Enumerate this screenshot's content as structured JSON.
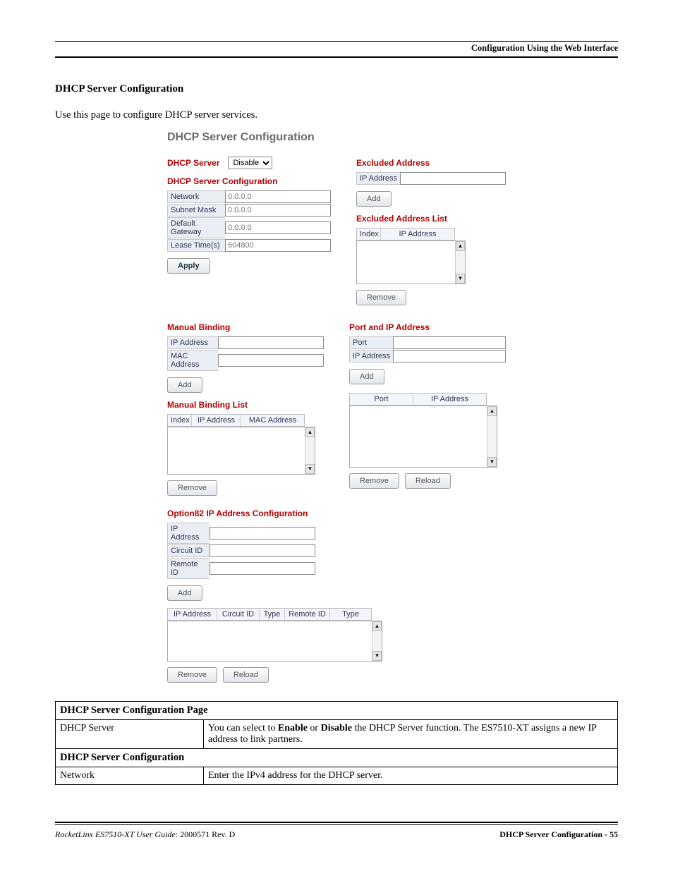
{
  "page_header": "Configuration Using the Web Interface",
  "section_title": "DHCP Server Configuration",
  "intro": "Use this page to configure DHCP server services.",
  "ui": {
    "panel_title": "DHCP Server Configuration",
    "dhcp_server_label": "DHCP Server",
    "dhcp_select_value": "Disable",
    "server_config_hdr": "DHCP Server Configuration",
    "fields": {
      "network": {
        "label": "Network",
        "placeholder": "0.0.0.0"
      },
      "subnet": {
        "label": "Subnet Mask",
        "placeholder": "0.0.0.0"
      },
      "gateway": {
        "label": "Default Gateway",
        "placeholder": "0.0.0.0"
      },
      "lease": {
        "label": "Lease Time(s)",
        "placeholder": "604800"
      }
    },
    "btn_apply": "Apply",
    "excluded_hdr": "Excluded Address",
    "excluded_ip_label": "IP Address",
    "btn_add": "Add",
    "excluded_list_hdr": "Excluded Address List",
    "exc_th_index": "Index",
    "exc_th_ip": "IP Address",
    "btn_remove": "Remove",
    "manual_binding_hdr": "Manual Binding",
    "mb_ip_label": "IP Address",
    "mb_mac_label": "MAC Address",
    "manual_list_hdr": "Manual Binding List",
    "mb_th_index": "Index",
    "mb_th_ip": "IP Address",
    "mb_th_mac": "MAC Address",
    "port_ip_hdr": "Port and IP Address",
    "pi_port": "Port",
    "pi_ip": "IP Address",
    "pi_th_port": "Port",
    "pi_th_ip": "IP Address",
    "btn_reload": "Reload",
    "opt82_hdr": "Option82 IP Address Configuration",
    "o82_ip": "IP Address",
    "o82_circuit": "Circuit ID",
    "o82_remote": "Remote ID",
    "o82_th_ip": "IP Address",
    "o82_th_circuit": "Circuit ID",
    "o82_th_type1": "Type",
    "o82_th_remote": "Remote ID",
    "o82_th_type2": "Type"
  },
  "table": {
    "title": "DHCP Server Configuration Page",
    "r1_label": "DHCP Server",
    "r1_text1": "You can select to ",
    "r1_b1": "Enable",
    "r1_mid": " or ",
    "r1_b2": "Disable",
    "r1_text2": " the DHCP Server function. The ES7510-XT assigns a new IP address to link partners.",
    "subhdr": "DHCP Server Configuration",
    "r2_label": "Network",
    "r2_text": "Enter the IPv4 address for the DHCP server."
  },
  "footer": {
    "left_italic": "RocketLinx ES7510-XT  User Guide",
    "left_rest": ": 2000571 Rev. D",
    "right": "DHCP Server Configuration - 55"
  }
}
